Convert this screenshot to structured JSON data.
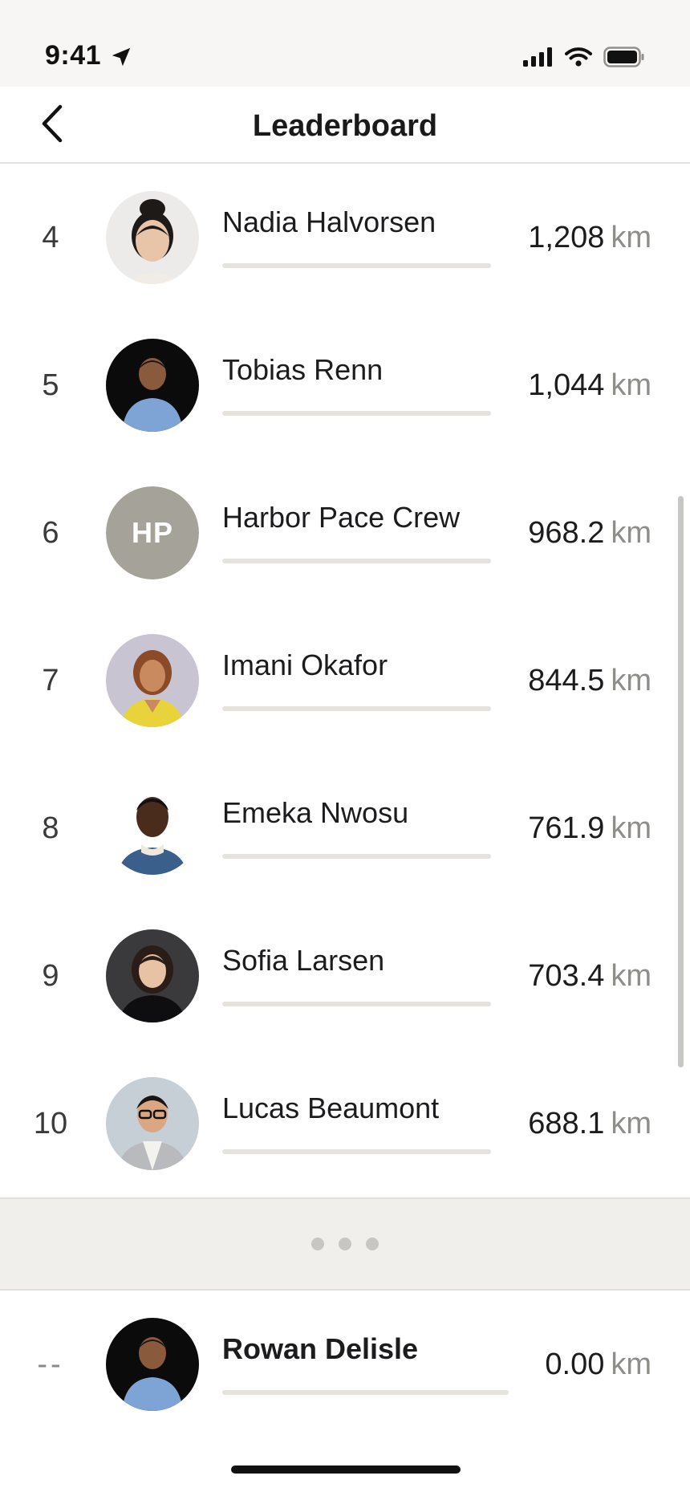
{
  "status_bar": {
    "time": "9:41",
    "location_icon": "location-arrow-icon",
    "signal_icon": "cellular-signal-icon",
    "wifi_icon": "wifi-icon",
    "battery_icon": "battery-icon"
  },
  "nav": {
    "title": "Leaderboard",
    "back_icon": "chevron-left-icon"
  },
  "colors": {
    "background": "#ffffff",
    "status_bg": "#f7f6f4",
    "divider": "#e2e0dd",
    "bar_track": "#e6e3df",
    "unit_text": "#8e8d8a",
    "initials_avatar": "#a5a29a",
    "gap_strip": "#f0efec"
  },
  "leaderboard": {
    "rows": [
      {
        "rank": "4",
        "name": "Nadia Halvorsen",
        "distance": "1,208",
        "unit": "km",
        "avatar": "photo"
      },
      {
        "rank": "5",
        "name": "Tobias Renn",
        "distance": "1,044",
        "unit": "km",
        "avatar": "photo"
      },
      {
        "rank": "6",
        "name": "Harbor Pace Crew",
        "distance": "968.2",
        "unit": "km",
        "avatar": "initials",
        "initials": "HP"
      },
      {
        "rank": "7",
        "name": "Imani Okafor",
        "distance": "844.5",
        "unit": "km",
        "avatar": "photo"
      },
      {
        "rank": "8",
        "name": "Emeka Nwosu",
        "distance": "761.9",
        "unit": "km",
        "avatar": "photo"
      },
      {
        "rank": "9",
        "name": "Sofia Larsen",
        "distance": "703.4",
        "unit": "km",
        "avatar": "photo"
      },
      {
        "rank": "10",
        "name": "Lucas Beaumont",
        "distance": "688.1",
        "unit": "km",
        "avatar": "photo"
      }
    ],
    "gap_indicator": "more-dots"
  },
  "current_user": {
    "rank": "--",
    "name": "Rowan Delisle",
    "distance": "0.00",
    "unit": "km",
    "avatar": "photo"
  }
}
